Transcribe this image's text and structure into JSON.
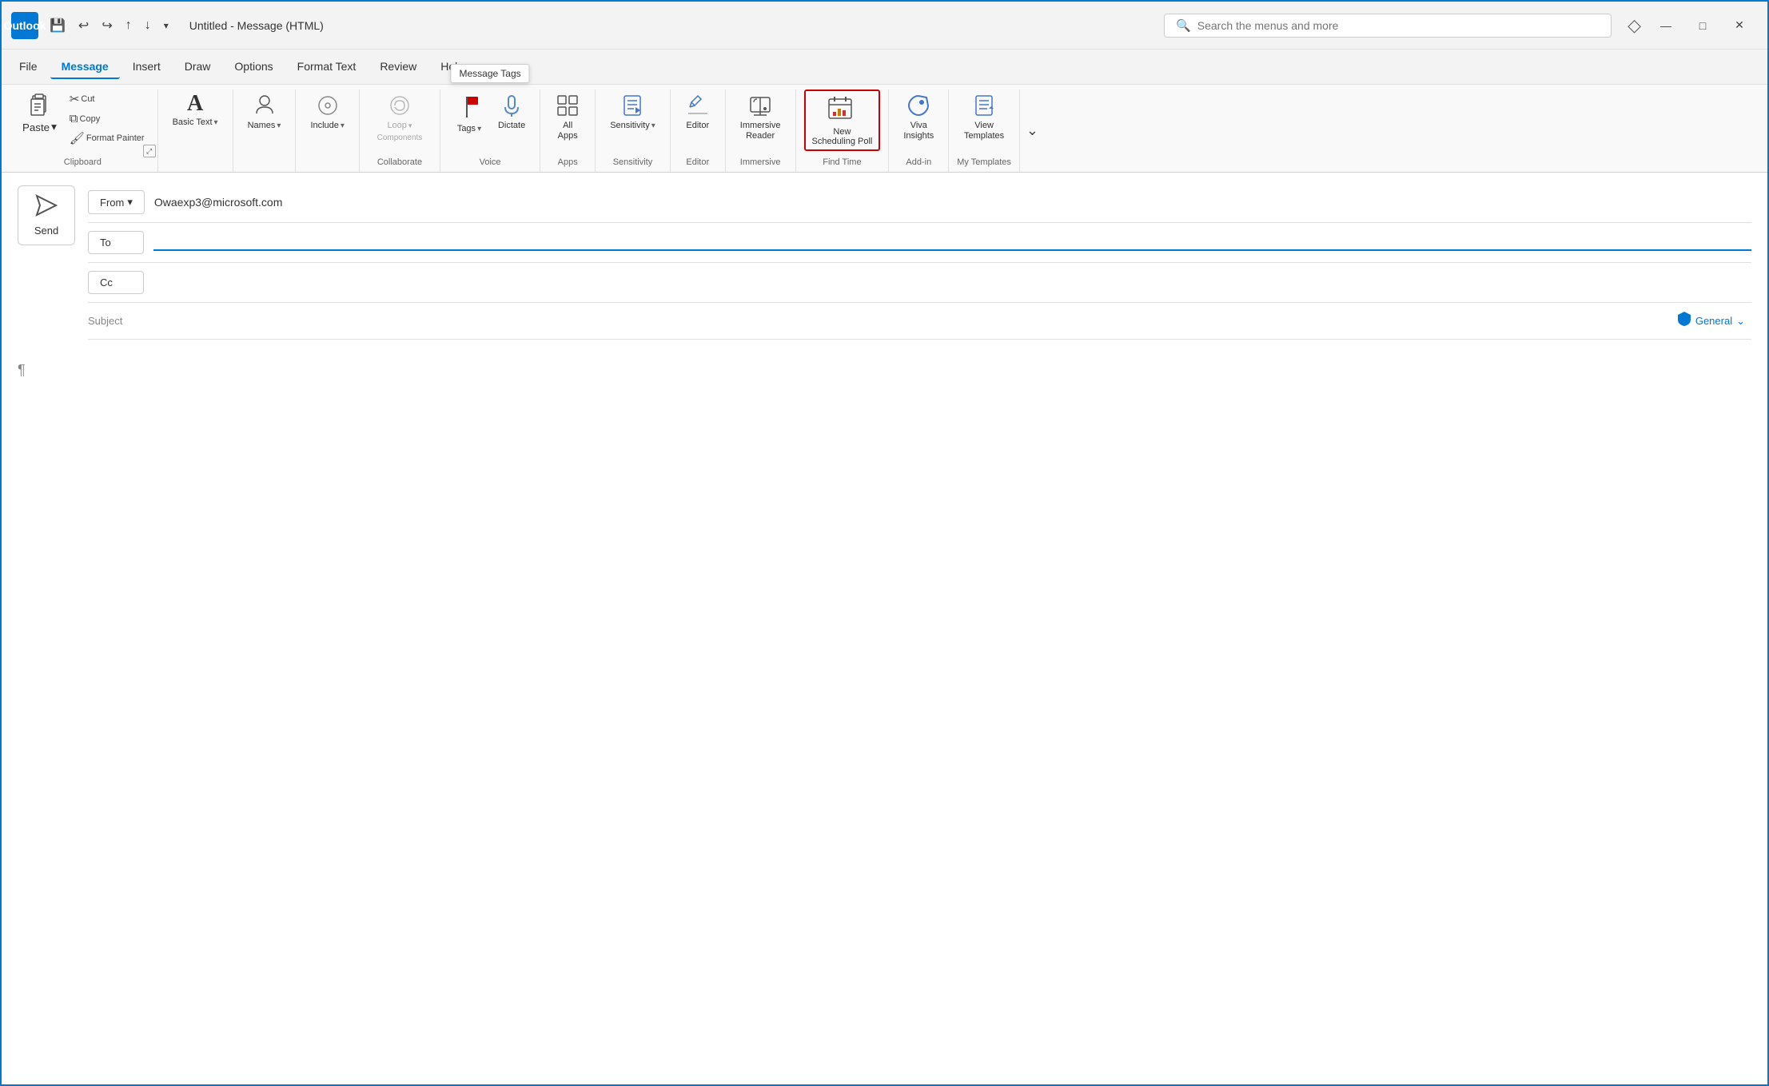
{
  "window": {
    "title": "Untitled - Message (HTML)",
    "app_name": "Outlook"
  },
  "titlebar": {
    "logo_text": "O",
    "undo_label": "↩",
    "redo_label": "↪",
    "up_label": "↑",
    "down_label": "↓",
    "dropdown_label": "▾",
    "search_placeholder": "Search the menus and more",
    "minimize_label": "—",
    "maximize_label": "□",
    "close_label": "✕"
  },
  "menubar": {
    "items": [
      {
        "id": "file",
        "label": "File"
      },
      {
        "id": "message",
        "label": "Message",
        "active": true
      },
      {
        "id": "insert",
        "label": "Insert"
      },
      {
        "id": "draw",
        "label": "Draw"
      },
      {
        "id": "options",
        "label": "Options"
      },
      {
        "id": "format_text",
        "label": "Format Text"
      },
      {
        "id": "review",
        "label": "Review"
      },
      {
        "id": "help",
        "label": "Help"
      }
    ]
  },
  "ribbon": {
    "groups": [
      {
        "id": "clipboard",
        "label": "Clipboard",
        "buttons": [
          {
            "id": "paste",
            "label": "Paste",
            "icon": "paste",
            "has_dropdown": true,
            "size": "large"
          },
          {
            "id": "cut",
            "label": "Cut",
            "icon": "cut"
          },
          {
            "id": "copy",
            "label": "Copy",
            "icon": "copy"
          },
          {
            "id": "format_painter",
            "label": "Format\nPainter",
            "icon": "format_painter"
          }
        ],
        "has_expand": true
      },
      {
        "id": "basic_text",
        "label": "Basic Text",
        "has_expand": false
      },
      {
        "id": "names",
        "label": "Names",
        "buttons": [
          {
            "id": "names",
            "label": "Names",
            "icon": "names",
            "has_dropdown": true
          }
        ]
      },
      {
        "id": "include",
        "label": "Include",
        "buttons": [
          {
            "id": "include",
            "label": "Include",
            "icon": "include",
            "has_dropdown": true
          }
        ]
      },
      {
        "id": "collaborate",
        "label": "Collaborate",
        "buttons": [
          {
            "id": "loop_components",
            "label": "Loop\nComponents",
            "icon": "loop",
            "has_dropdown": true,
            "disabled": true
          }
        ]
      },
      {
        "id": "tags_group",
        "label": "Voice",
        "buttons": [
          {
            "id": "tags",
            "label": "Tags",
            "icon": "tags",
            "has_dropdown": true
          },
          {
            "id": "dictate",
            "label": "Dictate",
            "icon": "dictate",
            "has_dropdown": false
          }
        ]
      },
      {
        "id": "apps",
        "label": "Apps",
        "buttons": [
          {
            "id": "all_apps",
            "label": "All\nApps",
            "icon": "apps"
          }
        ]
      },
      {
        "id": "sensitivity",
        "label": "Sensitivity",
        "buttons": [
          {
            "id": "sensitivity",
            "label": "Sensitivity",
            "icon": "sensitivity",
            "has_dropdown": true
          }
        ]
      },
      {
        "id": "editor_group",
        "label": "Editor",
        "buttons": [
          {
            "id": "editor",
            "label": "Editor",
            "icon": "editor"
          }
        ]
      },
      {
        "id": "immersive",
        "label": "Immersive",
        "buttons": [
          {
            "id": "immersive_reader",
            "label": "Immersive\nReader",
            "icon": "immersive_reader"
          }
        ]
      },
      {
        "id": "find_time",
        "label": "Find Time",
        "buttons": [
          {
            "id": "new_scheduling_poll",
            "label": "New\nScheduling Poll",
            "icon": "scheduling",
            "highlighted": true
          }
        ]
      },
      {
        "id": "add_in",
        "label": "Add-in",
        "buttons": [
          {
            "id": "viva_insights",
            "label": "Viva\nInsights",
            "icon": "viva"
          }
        ]
      },
      {
        "id": "my_templates",
        "label": "My Templates",
        "buttons": [
          {
            "id": "view_templates",
            "label": "View\nTemplates",
            "icon": "templates"
          }
        ]
      }
    ],
    "tooltip": "Message Tags",
    "more_label": "⌄"
  },
  "compose": {
    "send_label": "Send",
    "from_label": "From",
    "from_dropdown": "▾",
    "from_value": "Owaexp3@microsoft.com",
    "to_label": "To",
    "cc_label": "Cc",
    "subject_placeholder": "Subject",
    "general_label": "General",
    "general_chevron": "⌄",
    "paragraph_mark": "¶"
  }
}
